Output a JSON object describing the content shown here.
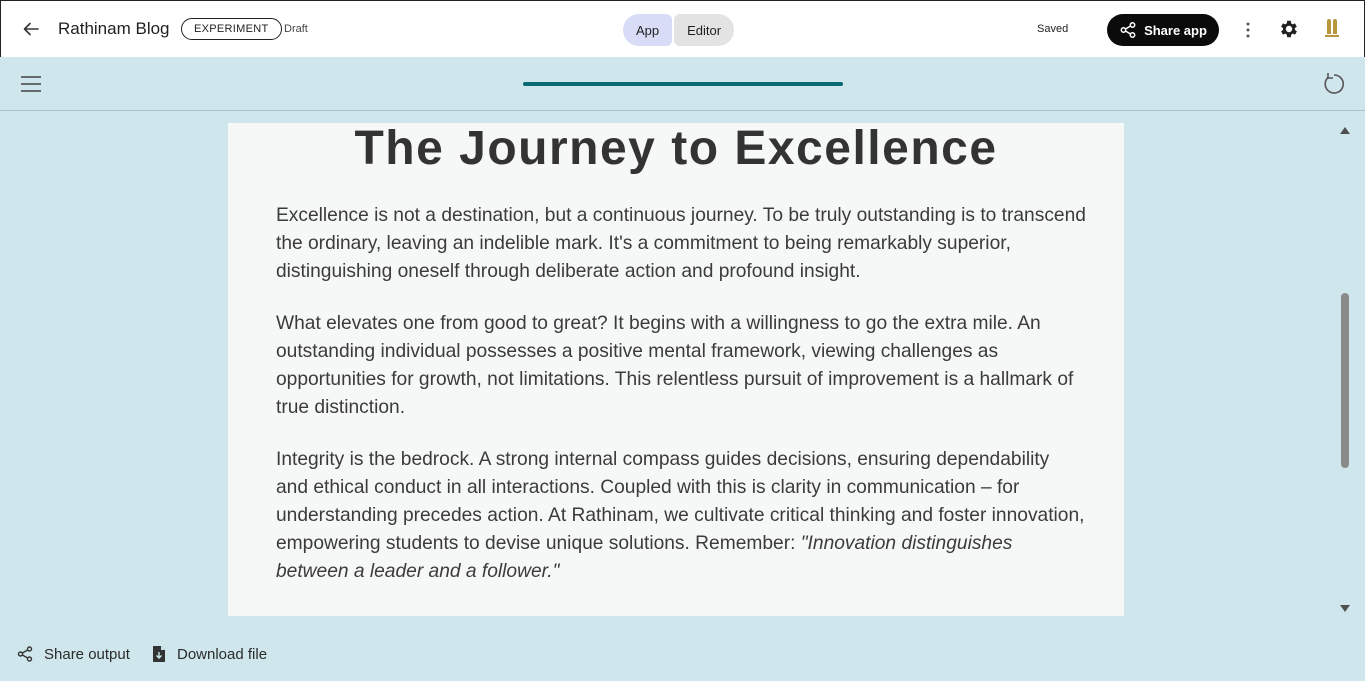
{
  "header": {
    "app_title": "Rathinam Blog",
    "badge": "EXPERIMENT",
    "status": "Draft",
    "mode_tabs": [
      "App",
      "Editor"
    ],
    "active_mode": "App",
    "save_status": "Saved",
    "share_app_label": "Share app"
  },
  "toolbar": {
    "progress_fraction": 1.0
  },
  "content": {
    "title": "The Journey to Excellence",
    "paragraphs": [
      "Excellence is not a destination, but a continuous journey. To be truly outstanding is to transcend the ordinary, leaving an indelible mark. It's a commitment to being remarkably superior, distinguishing oneself through deliberate action and profound insight.",
      "What elevates one from good to great? It begins with a willingness to go the extra mile. An outstanding individual possesses a positive mental framework, viewing challenges as opportunities for growth, not limitations. This relentless pursuit of improvement is a hallmark of true distinction.",
      "Integrity is the bedrock. A strong internal compass guides decisions, ensuring dependability and ethical conduct in all interactions. Coupled with this is clarity in communication – for understanding precedes action. At Rathinam, we cultivate critical thinking and foster innovation, empowering students to devise unique solutions. Remember: "
    ],
    "quote": "\"Innovation distinguishes between a leader and a follower.\""
  },
  "footer": {
    "share_output_label": "Share output",
    "download_file_label": "Download file"
  },
  "colors": {
    "background": "#cfe6ec",
    "accent": "#0b6b73",
    "active_mode": "#d9dcf7",
    "share_button": "#0b0b0b"
  },
  "icons": {
    "back": "arrow-left-icon",
    "share": "share-icon",
    "more": "more-vertical-icon",
    "settings": "gear-icon",
    "avatar": "logo-avatar",
    "menu": "hamburger-menu-icon",
    "refresh": "refresh-icon",
    "download": "download-file-icon"
  }
}
